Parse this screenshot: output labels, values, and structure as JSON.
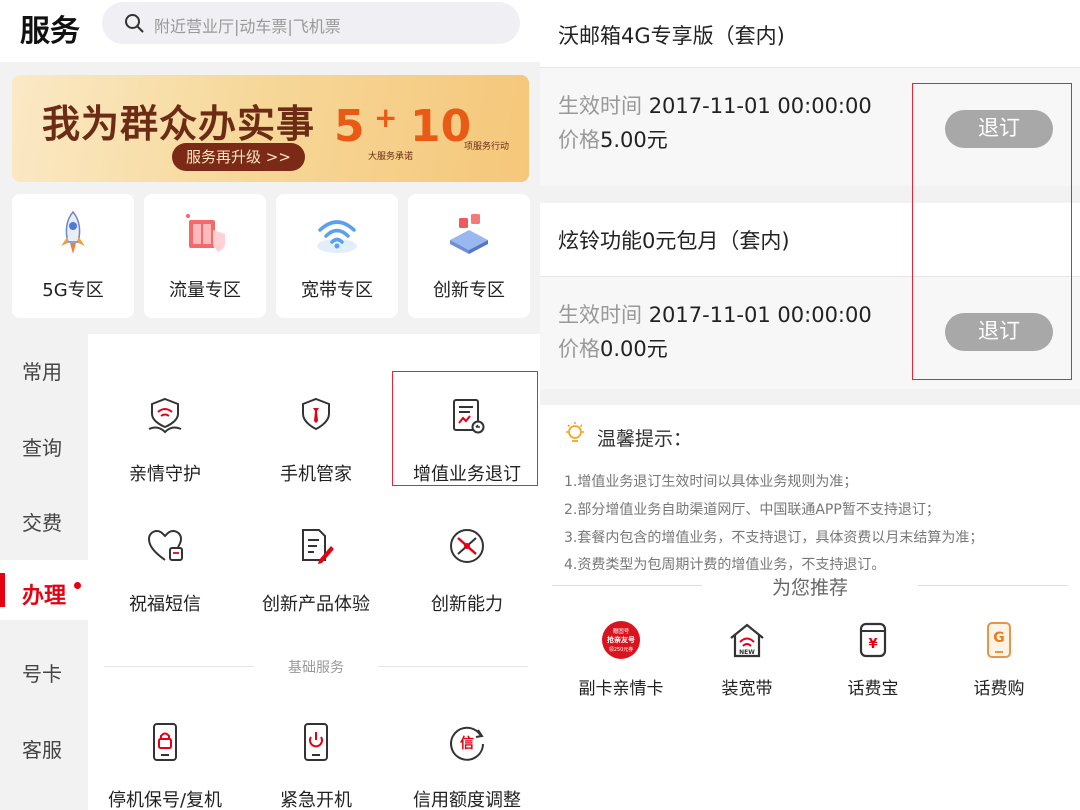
{
  "left": {
    "title": "服务",
    "search": {
      "placeholder": "附近营业厅|动车票|飞机票"
    },
    "banner": {
      "main": "我为群众办实事",
      "pill": "服务再升级 >>",
      "num_5": "5",
      "plus": "+",
      "num_10": "10",
      "sub_5": "大服务承诺",
      "sub_10": "项服务行动"
    },
    "zones": [
      {
        "label": "5G专区",
        "icon": "rocket-icon"
      },
      {
        "label": "流量专区",
        "icon": "data-box-icon"
      },
      {
        "label": "宽带专区",
        "icon": "wifi-icon"
      },
      {
        "label": "创新专区",
        "icon": "innovation-icon"
      }
    ],
    "sidenav": [
      {
        "label": "常用"
      },
      {
        "label": "查询"
      },
      {
        "label": "交费"
      },
      {
        "label": "办理",
        "active": true
      },
      {
        "label": "号卡"
      },
      {
        "label": "客服"
      }
    ],
    "services_row1": [
      {
        "label": "亲情守护",
        "icon": "family-guard-icon"
      },
      {
        "label": "手机管家",
        "icon": "phone-butler-icon"
      },
      {
        "label": "增值业务退订",
        "icon": "unsubscribe-doc-icon"
      }
    ],
    "services_row2": [
      {
        "label": "祝福短信",
        "icon": "heart-sms-icon"
      },
      {
        "label": "创新产品体验",
        "icon": "doc-pen-icon"
      },
      {
        "label": "创新能力",
        "icon": "capability-icon"
      }
    ],
    "section_label": "基础服务",
    "services_row3": [
      {
        "label": "停机保号/复机",
        "icon": "phone-lock-icon"
      },
      {
        "label": "紧急开机",
        "icon": "phone-power-icon"
      },
      {
        "label": "信用额度调整",
        "icon": "credit-icon"
      }
    ],
    "credit_glyph": "信"
  },
  "right": {
    "packages": [
      {
        "title": "沃邮箱4G专享版（套内)",
        "effective_label": "生效时间",
        "effective_value": "2017-11-01 00:00:00",
        "price_label": "价格",
        "price_value": "5.00元",
        "button": "退订"
      },
      {
        "title": "炫铃功能0元包月（套内)",
        "effective_label": "生效时间",
        "effective_value": "2017-11-01 00:00:00",
        "price_label": "价格",
        "price_value": "0.00元",
        "button": "退订"
      }
    ],
    "tips": {
      "title": "温馨提示：",
      "lines": [
        "1.增值业务退订生效时间以具体业务规则为准；",
        "2.部分增值业务自助渠道网厅、中国联通APP暂不支持退订；",
        "3.套餐内包含的增值业务，不支持退订，具体资费以月末结算为准；",
        "4.资费类型为包周期计费的增值业务，不支持退订。"
      ]
    },
    "recommend": {
      "title": "为您推荐",
      "items": [
        {
          "label": "副卡亲情卡",
          "icon": "family-card-icon",
          "badge_line1": "赠固号",
          "badge_line2": "抢亲友号",
          "badge_line3": "领250元券"
        },
        {
          "label": "装宽带",
          "icon": "broadband-new-icon",
          "badge": "NEW"
        },
        {
          "label": "话费宝",
          "icon": "bill-treasure-icon",
          "glyph": "¥"
        },
        {
          "label": "话费购",
          "icon": "bill-shop-icon",
          "glyph": "G"
        }
      ]
    }
  },
  "colors": {
    "brand_red": "#e60012",
    "button_gray": "#a8a8a8",
    "highlight_red": "#ee2233"
  }
}
